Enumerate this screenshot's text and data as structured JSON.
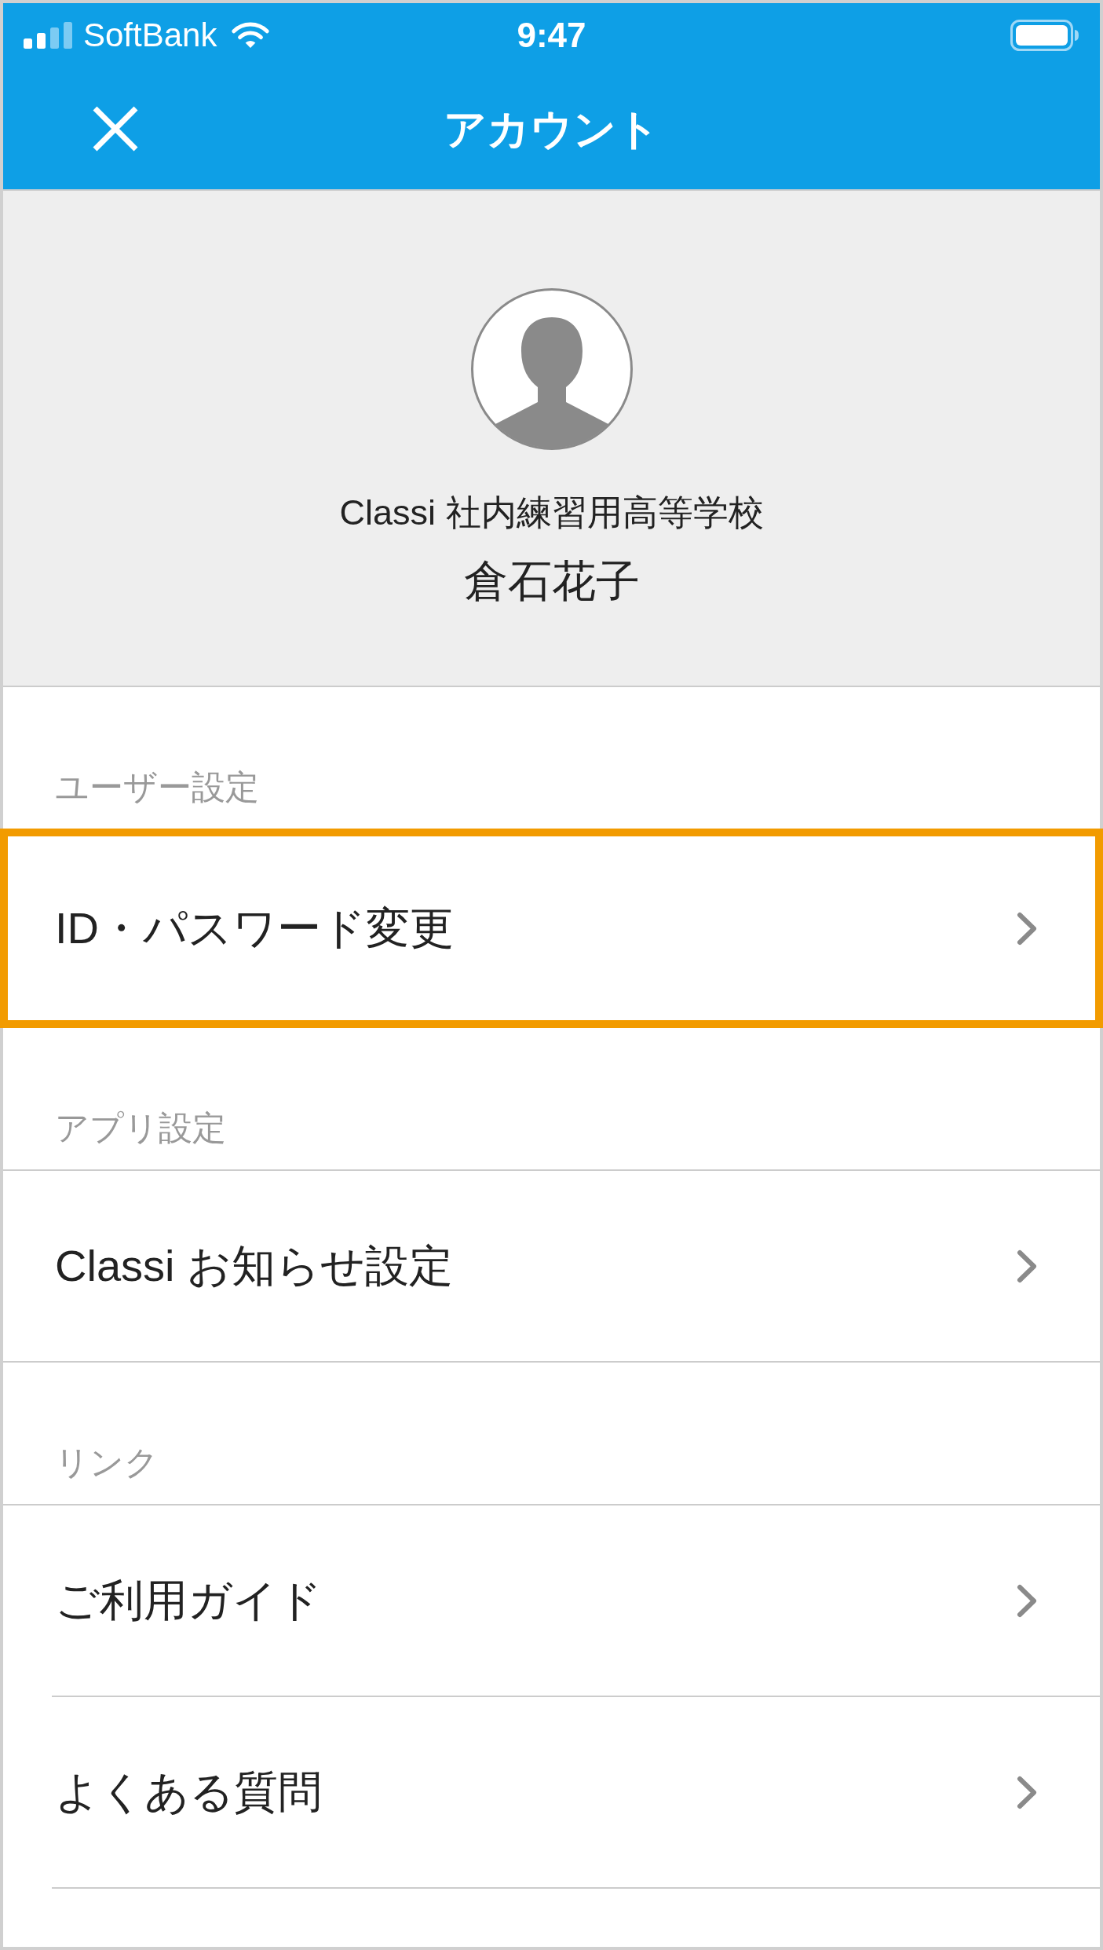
{
  "status_bar": {
    "carrier": "SoftBank",
    "time": "9:47"
  },
  "header": {
    "title": "アカウント"
  },
  "profile": {
    "school": "Classi 社内練習用高等学校",
    "name": "倉石花子"
  },
  "sections": [
    {
      "title": "ユーザー設定",
      "items": [
        {
          "label": "ID・パスワード変更",
          "highlighted": true
        }
      ]
    },
    {
      "title": "アプリ設定",
      "items": [
        {
          "label": "Classi お知らせ設定",
          "highlighted": false
        }
      ]
    },
    {
      "title": "リンク",
      "items": [
        {
          "label": "ご利用ガイド",
          "highlighted": false
        },
        {
          "label": "よくある質問",
          "highlighted": false
        }
      ]
    }
  ]
}
